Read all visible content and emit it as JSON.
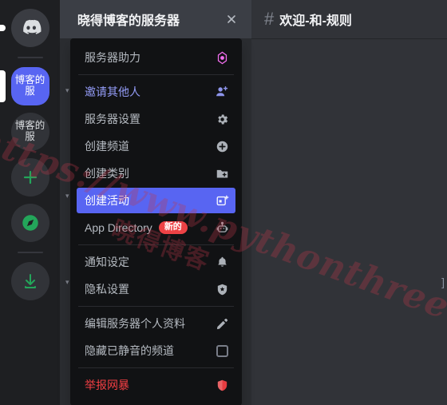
{
  "rail": {
    "items": [
      {
        "name": "home-button",
        "label": "",
        "icon": "discord-logo-icon",
        "state": "home"
      },
      {
        "name": "server-blog-active",
        "label": "博客的服",
        "icon": "server-avatar",
        "state": "selected"
      },
      {
        "name": "server-blog-second",
        "label": "博客的服",
        "icon": "server-avatar",
        "state": "idle"
      },
      {
        "name": "add-server-button",
        "label": "+",
        "icon": "plus-icon",
        "state": "green"
      },
      {
        "name": "explore-servers-button",
        "label": "",
        "icon": "compass-icon",
        "state": "green"
      },
      {
        "name": "download-apps-button",
        "label": "",
        "icon": "download-icon",
        "state": "green"
      }
    ]
  },
  "dropdown": {
    "title": "晓得博客的服务器",
    "close_label": "×",
    "items": [
      {
        "label": "服务器助力",
        "icon": "boost-gem-icon",
        "style": "normal",
        "badge": ""
      },
      {
        "label": "邀请其他人",
        "icon": "person-add-icon",
        "style": "invite",
        "badge": ""
      },
      {
        "label": "服务器设置",
        "icon": "gear-icon",
        "style": "normal",
        "badge": ""
      },
      {
        "label": "创建频道",
        "icon": "plus-circle-icon",
        "style": "normal",
        "badge": ""
      },
      {
        "label": "创建类别",
        "icon": "folder-add-icon",
        "style": "normal",
        "badge": ""
      },
      {
        "label": "创建活动",
        "icon": "calendar-add-icon",
        "style": "active",
        "badge": ""
      },
      {
        "label": "App Directory",
        "icon": "robot-icon",
        "style": "normal",
        "badge": "新的"
      },
      {
        "label": "通知设定",
        "icon": "bell-icon",
        "style": "normal",
        "badge": ""
      },
      {
        "label": "隐私设置",
        "icon": "shield-star-icon",
        "style": "normal",
        "badge": ""
      },
      {
        "label": "编辑服务器个人资料",
        "icon": "pencil-icon",
        "style": "normal",
        "badge": ""
      },
      {
        "label": "隐藏已静音的频道",
        "icon": "checkbox-icon",
        "style": "normal",
        "badge": ""
      },
      {
        "label": "举报网暴",
        "icon": "report-shield-icon",
        "style": "danger",
        "badge": ""
      }
    ]
  },
  "channel_header": {
    "hash": "#",
    "name": "欢迎-和-规则"
  },
  "main_area": {
    "edge_char": "]"
  },
  "watermark": {
    "url": "https://www.pythonthree.com",
    "brand": "晓得博客"
  },
  "colors": {
    "accent": "#5865f2",
    "danger": "#f23f43",
    "badge": "#ed4245",
    "invite_link": "#949cf7",
    "menu_bg": "#111214",
    "header_bg": "#3b3e45",
    "rail_bg": "#1e1f22",
    "channel_bg": "#2b2d31",
    "chat_bg": "#313338",
    "green": "#23a55a",
    "boost_pink": "#ff73fa"
  }
}
